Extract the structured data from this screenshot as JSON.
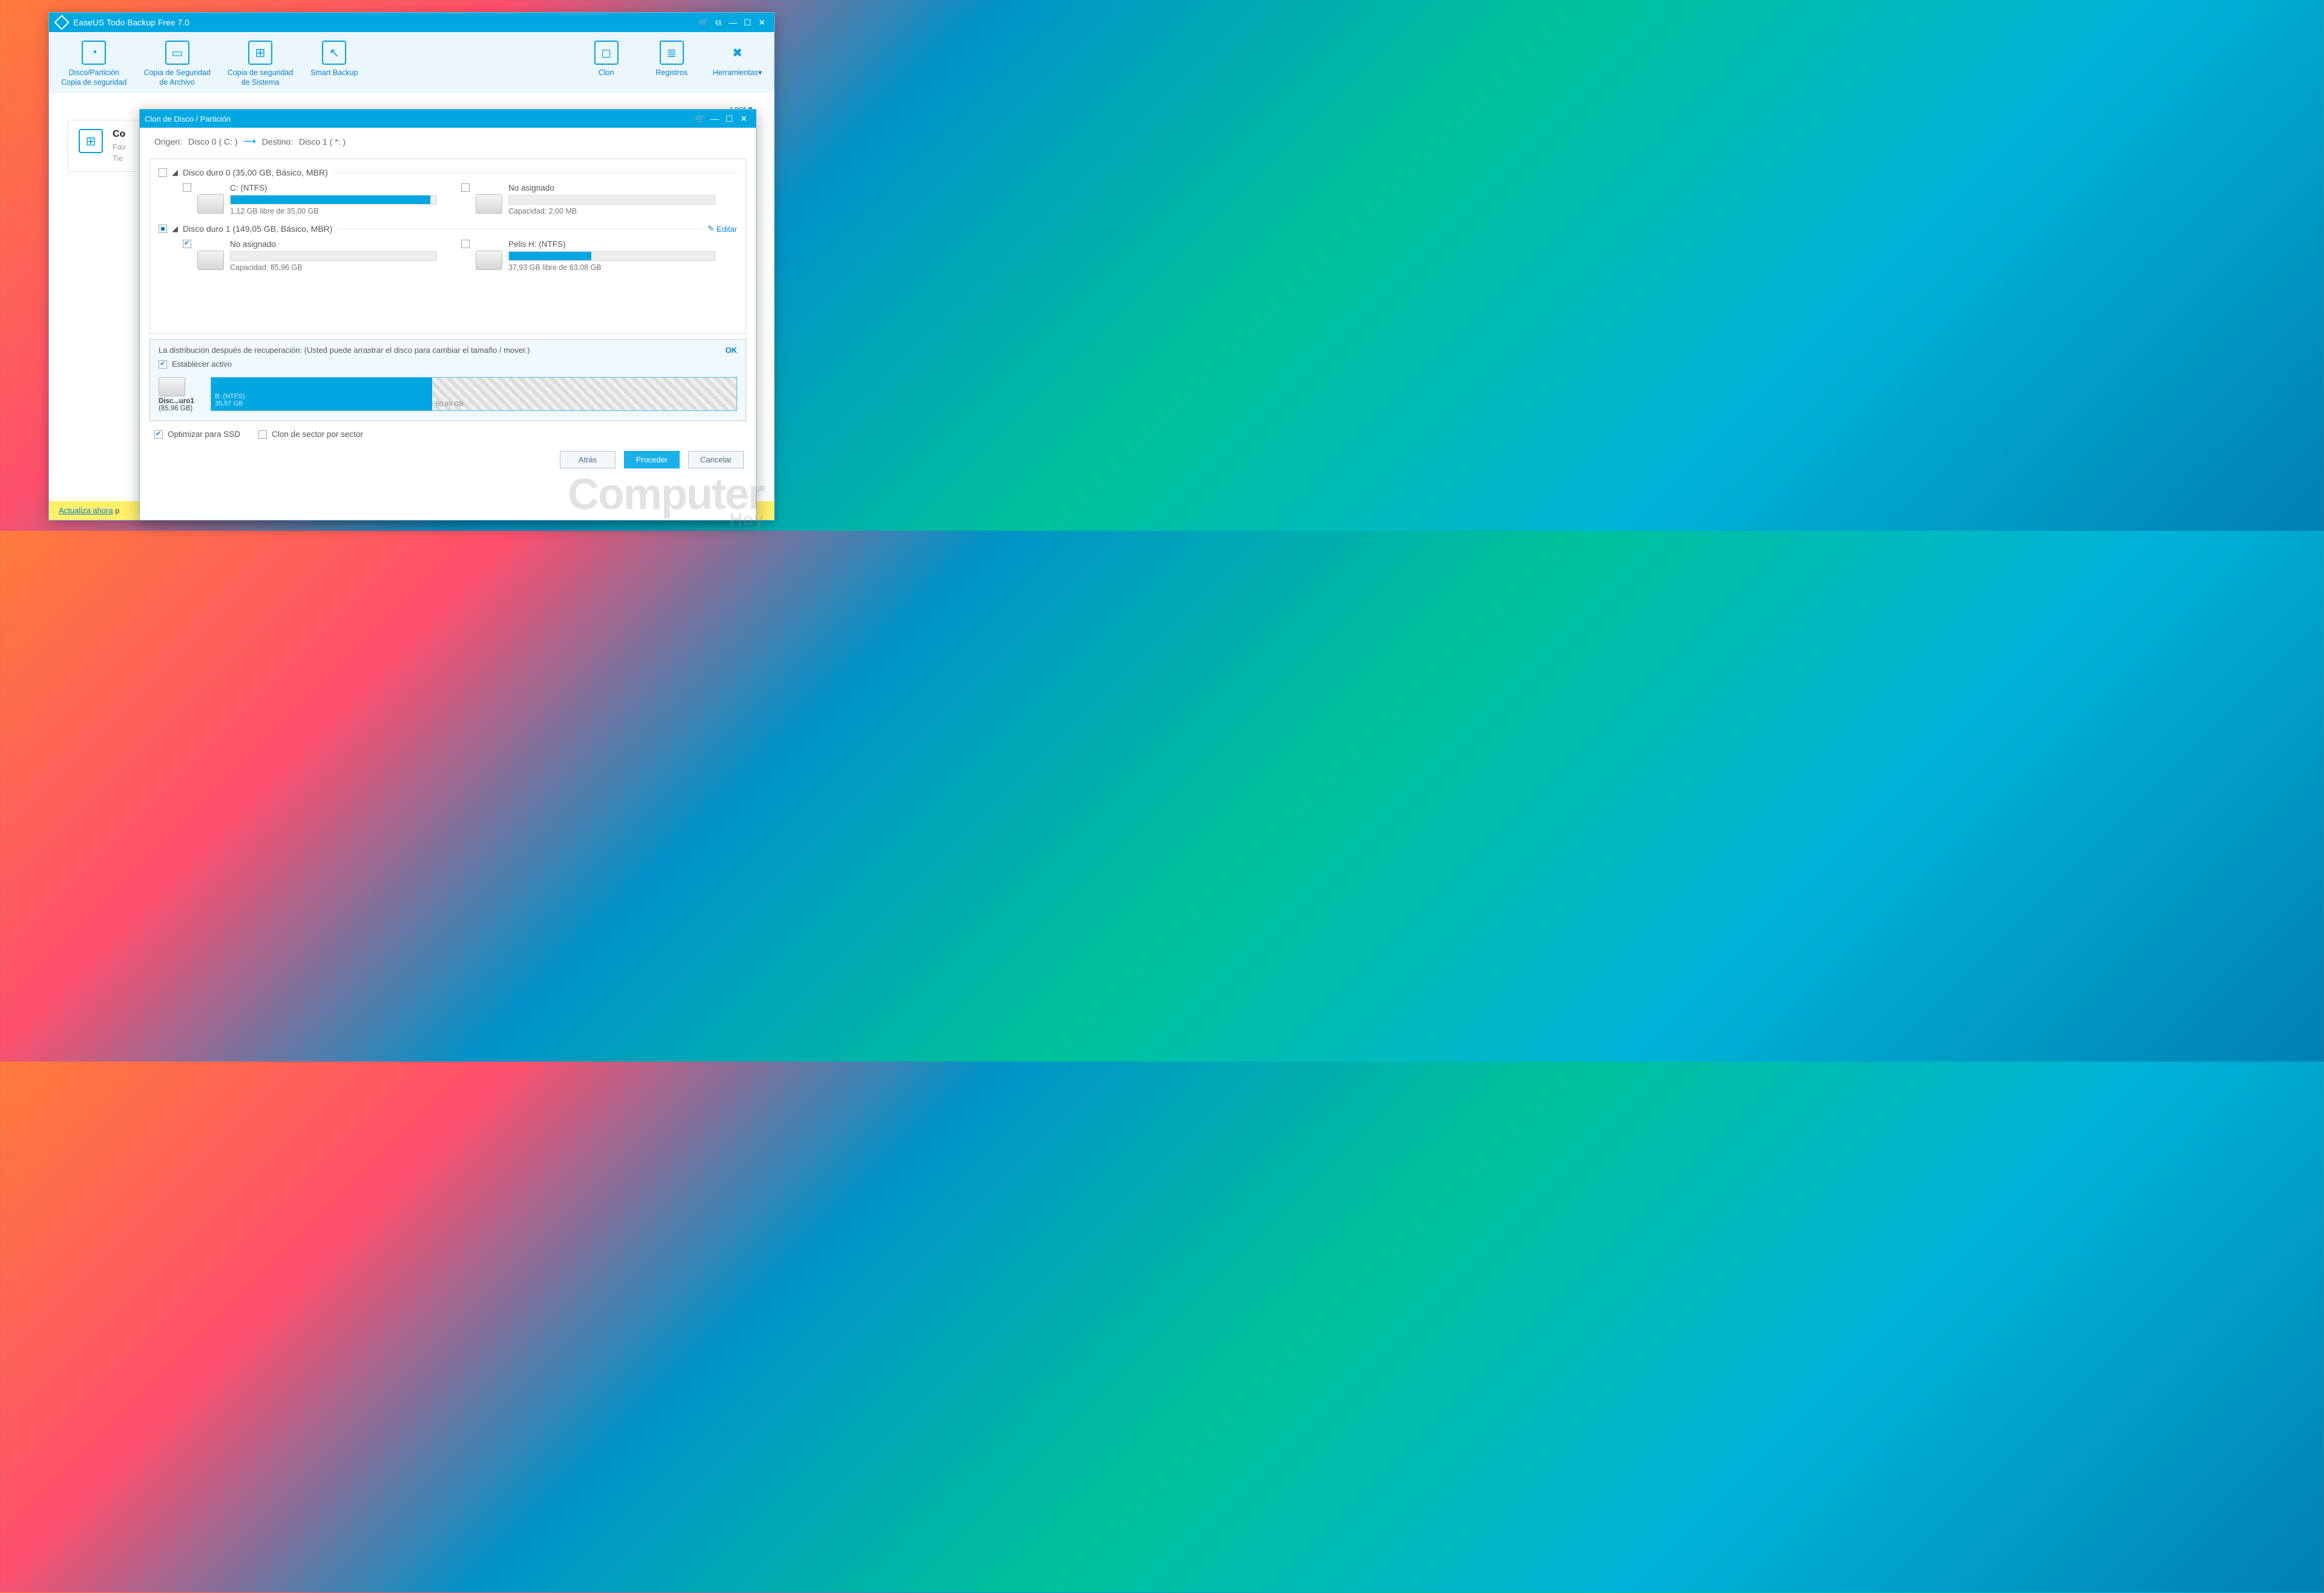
{
  "main_window": {
    "title": "EaseUS Todo Backup Free 7.0",
    "toolbar": {
      "disk_partition": "Disco/Partición\nCopia de seguridad",
      "file_backup": "Copia de Seguridad\nde Archivo",
      "system_backup": "Copia de seguridad\nde Sistema",
      "smart_backup": "Smart Backup",
      "clone": "Clon",
      "logs": "Registros",
      "tools": "Herramientas"
    },
    "sort_by": "r por",
    "card": {
      "title_prefix": "Co",
      "fav": "Fav",
      "tie": "Tie"
    },
    "footer": {
      "link": "Actualiza ahora",
      "suffix": " p"
    }
  },
  "dialog": {
    "title": "Clon de Disco / Partición",
    "path": {
      "origen_label": "Origen:",
      "origen_value": "Disco 0 ( C: )",
      "destino_label": "Destino:",
      "destino_value": "Disco 1 ( *: )"
    },
    "disk0": {
      "header": "Disco duro 0 (35,00 GB, Básico, MBR)",
      "part_c": {
        "name": "C: (NTFS)",
        "stat": "1,12 GB libre de 35,00 GB",
        "fill_pct": 97
      },
      "part_un": {
        "name": "No asignado",
        "stat": "Capacidad: 2,00 MB",
        "fill_pct": 0
      }
    },
    "disk1": {
      "header": "Disco duro 1 (149,05 GB, Básico, MBR)",
      "edit": "Editar",
      "part_un": {
        "name": "No asignado",
        "stat": "Capacidad: 85,96 GB",
        "fill_pct": 0
      },
      "part_h": {
        "name": "Pelis H: (NTFS)",
        "stat": "37,93 GB libre de 63,08 GB",
        "fill_pct": 40
      }
    },
    "layout": {
      "text": "La distribución después de recuperación: (Usted puede arrastrar el disco para cambiar el tamaño / mover.)",
      "ok": "OK",
      "set_active": "Establecer activo",
      "disk_label": "Disc...uro1",
      "disk_cap": "(85,96 GB)",
      "seg1_name": "B: (NTFS)",
      "seg1_size": "35,57 GB",
      "seg2_size": "50,89 GB"
    },
    "options": {
      "ssd": "Optimizar para SSD",
      "sector": "Clon de sector por sector"
    },
    "buttons": {
      "back": "Atrás",
      "proceed": "Proceder",
      "cancel": "Cancelar"
    }
  },
  "watermark": {
    "line1": "Computer",
    "line2": "Hoy"
  }
}
